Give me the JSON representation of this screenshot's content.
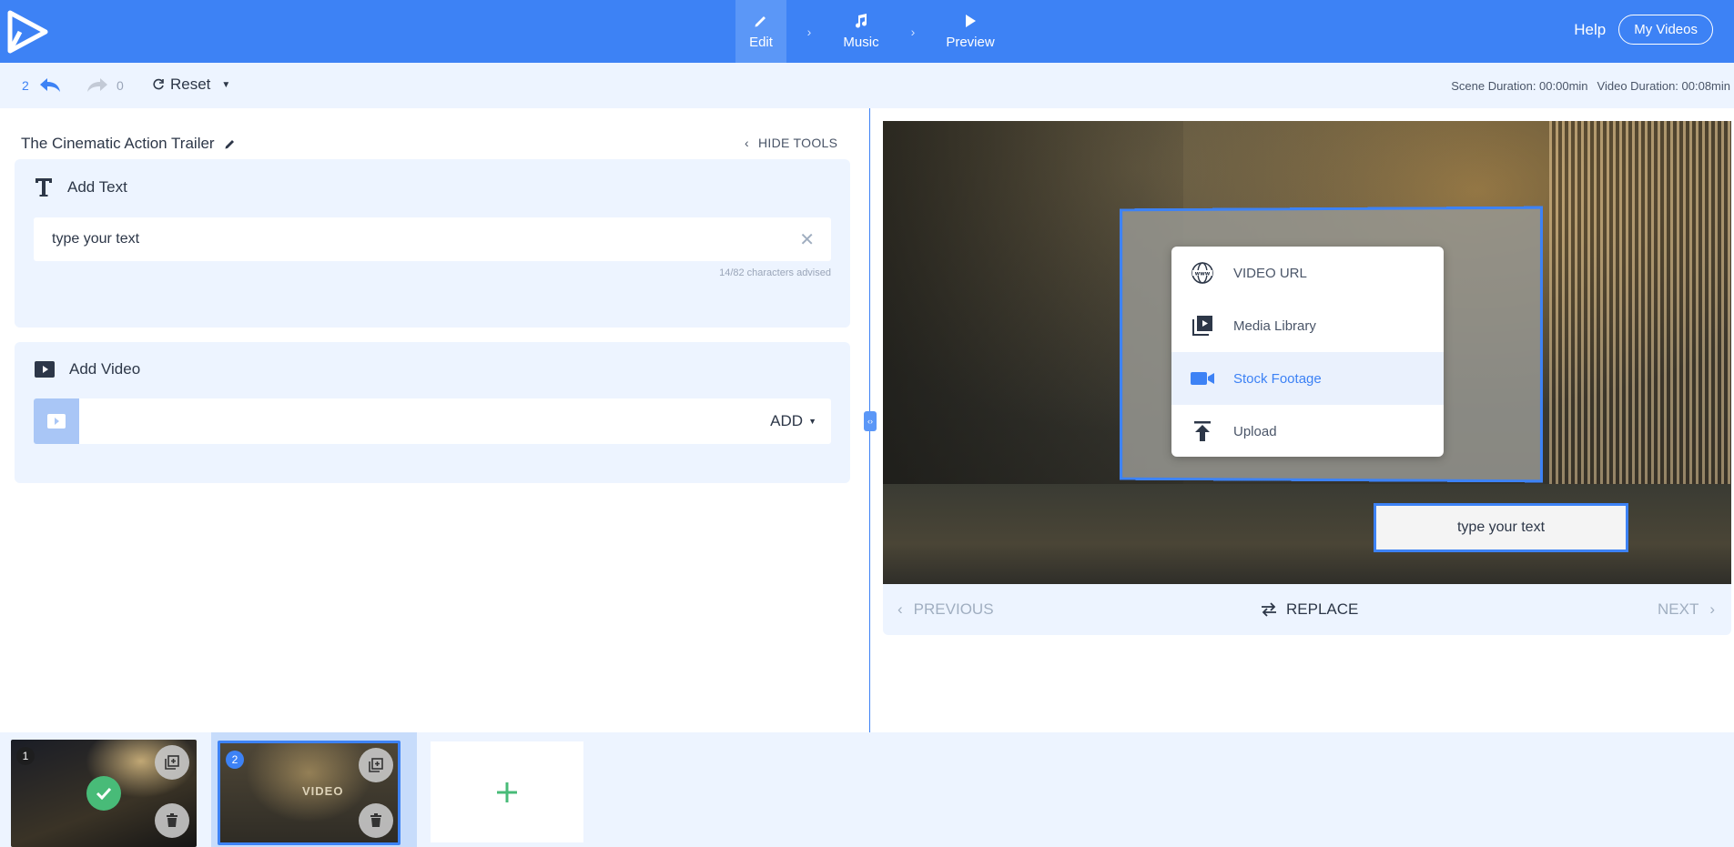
{
  "nav": {
    "steps": [
      {
        "label": "Edit",
        "icon": "pencil-icon",
        "active": true
      },
      {
        "label": "Music",
        "icon": "music-note-icon",
        "active": false
      },
      {
        "label": "Preview",
        "icon": "play-icon",
        "active": false
      }
    ],
    "help_label": "Help",
    "my_videos_label": "My Videos"
  },
  "toolbar": {
    "undo_count": "2",
    "redo_count": "0",
    "reset_label": "Reset",
    "scene_duration": "Scene Duration: 00:00min",
    "video_duration": "Video Duration: 00:08min"
  },
  "editor": {
    "project_title": "The Cinematic Action Trailer",
    "hide_tools_label": "HIDE TOOLS",
    "add_text": {
      "heading": "Add Text",
      "value": "type your text",
      "char_hint": "14/82 characters advised"
    },
    "add_video": {
      "heading": "Add Video",
      "add_label": "ADD"
    }
  },
  "preview": {
    "media_menu": [
      {
        "label": "VIDEO URL",
        "icon": "globe-www-icon",
        "active": false
      },
      {
        "label": "Media Library",
        "icon": "media-library-icon",
        "active": false
      },
      {
        "label": "Stock Footage",
        "icon": "video-camera-icon",
        "active": true
      },
      {
        "label": "Upload",
        "icon": "upload-icon",
        "active": false
      }
    ],
    "text_overlay": "type your text",
    "previous_label": "PREVIOUS",
    "replace_label": "REPLACE",
    "next_label": "NEXT"
  },
  "scenes": [
    {
      "number": "1",
      "selected": false,
      "completed": true
    },
    {
      "number": "2",
      "selected": true,
      "thumb_text": "VIDEO"
    }
  ],
  "colors": {
    "accent": "#3d82f5",
    "panel": "#edf4ff",
    "success": "#48bb78"
  }
}
